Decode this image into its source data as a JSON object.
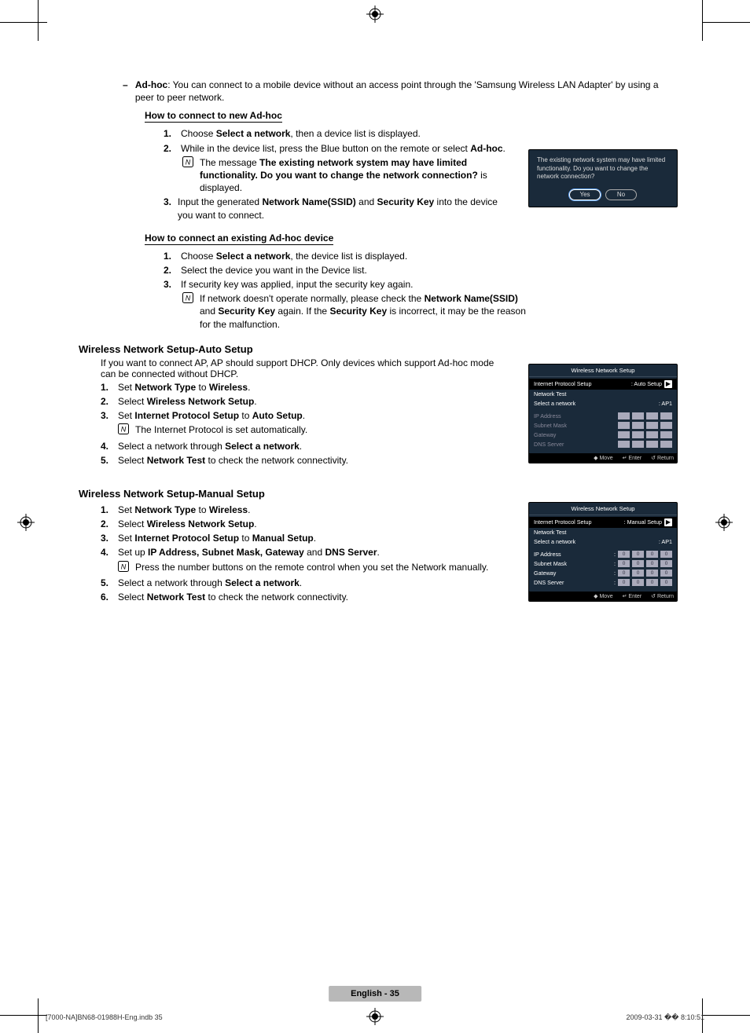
{
  "adhoc": {
    "label": "Ad-hoc",
    "desc_full": ": You can connect to a mobile device without an access point through the 'Samsung Wireless LAN Adapter' by using a peer to peer network."
  },
  "howto_new": {
    "title": "How to connect to new Ad-hoc",
    "step1_pre": "Choose ",
    "step1_bold": "Select a network",
    "step1_post": ", then a device list is displayed.",
    "step2_pre": "While in the device list, press the Blue button on the remote or select ",
    "step2_bold": "Ad-hoc",
    "step2_post": ".",
    "note_pre": "The message ",
    "note_bold": "The existing network system may have limited functionality. Do you want to change the network connection?",
    "note_post": " is displayed.",
    "step3_pre": "Input the generated ",
    "step3_b1": "Network Name(SSID)",
    "step3_mid": " and ",
    "step3_b2": "Security Key",
    "step3_post": " into the device you want to connect."
  },
  "dialog": {
    "msg": "The existing network system may have limited functionality. Do you want to change the network connection?",
    "yes": "Yes",
    "no": "No"
  },
  "howto_existing": {
    "title": "How to connect an existing Ad-hoc device",
    "step1_pre": "Choose ",
    "step1_bold": "Select a network",
    "step1_post": ", the device list is displayed.",
    "step2": "Select the device you want in the Device list.",
    "step3": "If security key was applied, input the security key again.",
    "note_pre": "If network doesn't operate normally, please check the ",
    "note_b1": "Network Name(SSID)",
    "note_mid1": " and ",
    "note_b2": "Security Key",
    "note_mid2": " again. If the ",
    "note_b3": "Security Key",
    "note_post": " is incorrect, it may be the reason for the malfunction."
  },
  "auto_setup": {
    "title": "Wireless Network Setup-Auto Setup",
    "intro": "If you want to connect AP, AP should support DHCP. Only devices which support Ad-hoc mode can be connected without DHCP.",
    "s1_pre": "Set ",
    "s1_b1": "Network Type",
    "s1_mid": " to ",
    "s1_b2": "Wireless",
    "s1_post": ".",
    "s2_pre": "Select ",
    "s2_b": "Wireless Network Setup",
    "s2_post": ".",
    "s3_pre": "Set ",
    "s3_b1": "Internet Protocol Setup",
    "s3_mid": " to ",
    "s3_b2": "Auto Setup",
    "s3_post": ".",
    "s3_note": "The Internet Protocol is set automatically.",
    "s4_pre": "Select a network through ",
    "s4_b": "Select a network",
    "s4_post": ".",
    "s5_pre": "Select ",
    "s5_b": "Network Test",
    "s5_post": " to check the network connectivity."
  },
  "manual_setup": {
    "title": "Wireless Network Setup-Manual Setup",
    "s1_pre": "Set ",
    "s1_b1": "Network Type",
    "s1_mid": " to ",
    "s1_b2": "Wireless",
    "s1_post": ".",
    "s2_pre": "Select ",
    "s2_b": "Wireless Network Setup",
    "s2_post": ".",
    "s3_pre": "Set ",
    "s3_b1": "Internet Protocol Setup",
    "s3_mid": " to ",
    "s3_b2": "Manual Setup",
    "s3_post": ".",
    "s4_pre": "Set up ",
    "s4_b": "IP Address, Subnet Mask, Gateway",
    "s4_mid": " and ",
    "s4_b2": "DNS Server",
    "s4_post": ".",
    "s4_note": "Press the number buttons on the remote control when you set the Network manually.",
    "s5_pre": "Select a network through ",
    "s5_b": "Select a network",
    "s5_post": ".",
    "s6_pre": "Select ",
    "s6_b": "Network Test",
    "s6_post": " to check the network connectivity."
  },
  "panel_auto": {
    "title": "Wireless Network Setup",
    "ips": "Internet Protocol Setup",
    "ips_val": ": Auto Setup",
    "ntest": "Network Test",
    "san": "Select a network",
    "san_val": ": AP1",
    "ip": "IP Address",
    "subnet": "Subnet Mask",
    "gateway": "Gateway",
    "dns": "DNS Server",
    "move": "Move",
    "enter": "Enter",
    "return": "Return"
  },
  "panel_manual": {
    "title": "Wireless Network Setup",
    "ips": "Internet Protocol Setup",
    "ips_val": ": Manual Setup",
    "ntest": "Network Test",
    "san": "Select a network",
    "san_val": ": AP1",
    "ip": "IP Address",
    "subnet": "Subnet Mask",
    "gateway": "Gateway",
    "dns": "DNS Server",
    "ip_vals": [
      "0",
      "0",
      "0",
      "0"
    ],
    "sn_vals": [
      "0",
      "0",
      "0",
      "0"
    ],
    "gw_vals": [
      "0",
      "0",
      "0",
      "0"
    ],
    "dns_vals": [
      "0",
      "0",
      "0",
      "0"
    ],
    "move": "Move",
    "enter": "Enter",
    "return": "Return"
  },
  "nums": {
    "n1": "1.",
    "n2": "2.",
    "n3": "3.",
    "n4": "4.",
    "n5": "5.",
    "n6": "6."
  },
  "dash": "–",
  "foot_lang": "English - 35",
  "footer_left": "[7000-NA]BN68-01988H-Eng.indb   35",
  "footer_right": "2009-03-31   �� 8:10:51",
  "icons": {
    "note": "N",
    "diamond": "◆",
    "enter": "↵",
    "return": "↺",
    "arrow": "▶"
  }
}
